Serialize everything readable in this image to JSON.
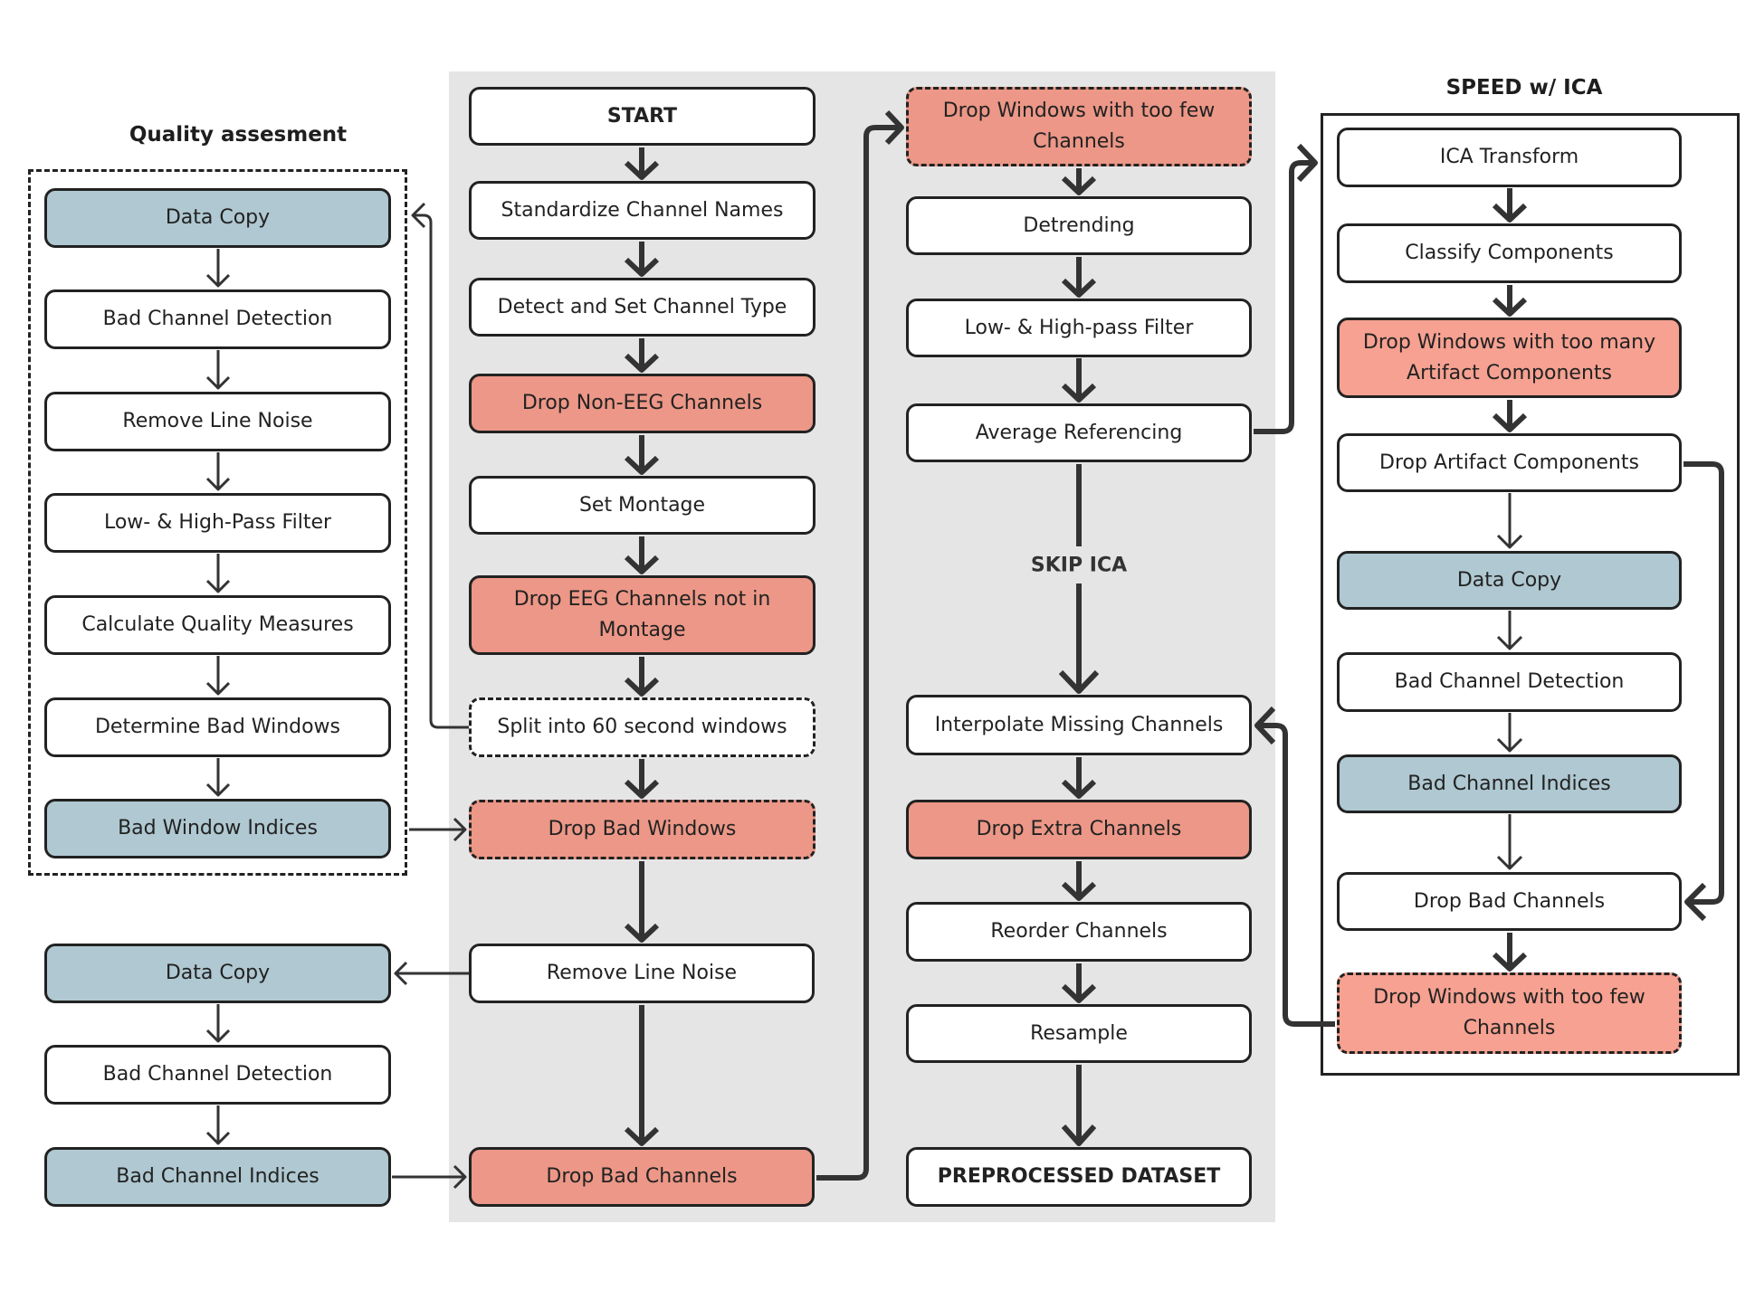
{
  "titles": {
    "quality": "Quality assesment",
    "speed": "SPEED w/ ICA",
    "skip_ica": "SKIP ICA"
  },
  "colors": {
    "drop": "#ec9787",
    "drop_ica": "#f6a191",
    "copy": "#afc8d1",
    "panel": "#e5e5e5",
    "line": "#333333"
  },
  "quality": [
    {
      "id": "qa-data-copy",
      "label": "Data Copy",
      "kind": "copy"
    },
    {
      "id": "qa-bad-channel-detection",
      "label": "Bad Channel Detection",
      "kind": "plain"
    },
    {
      "id": "qa-remove-line-noise",
      "label": "Remove Line Noise",
      "kind": "plain"
    },
    {
      "id": "qa-filter",
      "label": "Low- & High-Pass Filter",
      "kind": "plain"
    },
    {
      "id": "qa-calc-quality",
      "label": "Calculate Quality Measures",
      "kind": "plain"
    },
    {
      "id": "qa-determine-bad-windows",
      "label": "Determine Bad Windows",
      "kind": "plain"
    },
    {
      "id": "qa-bad-window-indices",
      "label": "Bad Window Indices",
      "kind": "copy"
    }
  ],
  "bad_channels_side": [
    {
      "id": "side-data-copy",
      "label": "Data Copy",
      "kind": "copy"
    },
    {
      "id": "side-bad-channel-detection",
      "label": "Bad Channel Detection",
      "kind": "plain"
    },
    {
      "id": "side-bad-channel-indices",
      "label": "Bad Channel Indices",
      "kind": "copy"
    }
  ],
  "main_col1": [
    {
      "id": "start",
      "label": "START",
      "kind": "bold"
    },
    {
      "id": "standardize-names",
      "label": "Standardize Channel Names",
      "kind": "plain"
    },
    {
      "id": "detect-channel-type",
      "label": "Detect and Set Channel Type",
      "kind": "plain"
    },
    {
      "id": "drop-non-eeg",
      "label": "Drop Non-EEG Channels",
      "kind": "drop"
    },
    {
      "id": "set-montage",
      "label": "Set Montage",
      "kind": "plain"
    },
    {
      "id": "drop-not-in-montage",
      "label": "Drop EEG Channels not in Montage",
      "kind": "drop"
    },
    {
      "id": "split-windows",
      "label": "Split into 60 second windows",
      "kind": "dashed"
    },
    {
      "id": "drop-bad-windows",
      "label": "Drop Bad Windows",
      "kind": "drop-dashed"
    },
    {
      "id": "remove-line-noise",
      "label": "Remove Line Noise",
      "kind": "plain"
    },
    {
      "id": "drop-bad-channels",
      "label": "Drop Bad Channels",
      "kind": "drop"
    }
  ],
  "main_col2": [
    {
      "id": "drop-few-channels",
      "label": "Drop Windows with too few Channels",
      "kind": "drop-dashed"
    },
    {
      "id": "detrending",
      "label": "Detrending",
      "kind": "plain"
    },
    {
      "id": "filter",
      "label": "Low- & High-pass Filter",
      "kind": "plain"
    },
    {
      "id": "average-referencing",
      "label": "Average Referencing",
      "kind": "plain"
    },
    {
      "id": "interpolate-missing",
      "label": "Interpolate Missing Channels",
      "kind": "plain"
    },
    {
      "id": "drop-extra-channels",
      "label": "Drop Extra Channels",
      "kind": "drop"
    },
    {
      "id": "reorder-channels",
      "label": "Reorder Channels",
      "kind": "plain"
    },
    {
      "id": "resample",
      "label": "Resample",
      "kind": "plain"
    },
    {
      "id": "preprocessed-dataset",
      "label": "PREPROCESSED DATASET",
      "kind": "bold"
    }
  ],
  "ica": [
    {
      "id": "ica-transform",
      "label": "ICA Transform",
      "kind": "plain"
    },
    {
      "id": "classify-components",
      "label": "Classify Components",
      "kind": "plain"
    },
    {
      "id": "drop-many-artifacts",
      "label": "Drop Windows with too many Artifact Components",
      "kind": "drop2"
    },
    {
      "id": "drop-artifact-components",
      "label": "Drop Artifact Components",
      "kind": "plain"
    },
    {
      "id": "ica-data-copy",
      "label": "Data Copy",
      "kind": "copy"
    },
    {
      "id": "ica-bad-channel-detection",
      "label": "Bad Channel Detection",
      "kind": "plain"
    },
    {
      "id": "ica-bad-channel-indices",
      "label": "Bad Channel Indices",
      "kind": "copy"
    },
    {
      "id": "ica-drop-bad-channels",
      "label": "Drop Bad Channels",
      "kind": "plain"
    },
    {
      "id": "ica-drop-few-channels",
      "label": "Drop Windows with too few Channels",
      "kind": "drop2-dashed"
    }
  ]
}
